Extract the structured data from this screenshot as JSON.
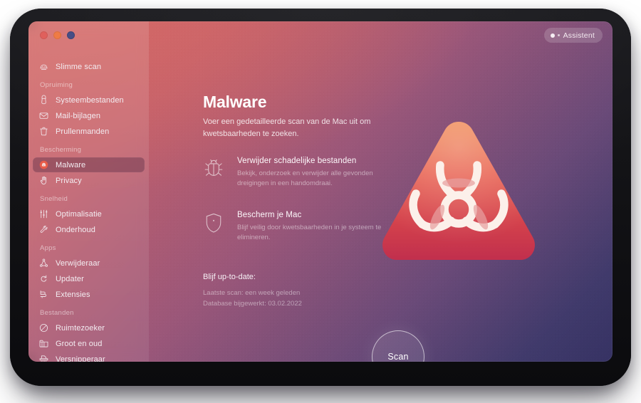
{
  "window": {
    "traffic_lights": [
      {
        "name": "close",
        "color": "#e0605c"
      },
      {
        "name": "minimize",
        "color": "#ef7b45"
      },
      {
        "name": "maximize",
        "color": "#474e86"
      }
    ],
    "assistant_label": "Assistent"
  },
  "sidebar": {
    "top_item": {
      "label": "Slimme scan",
      "icon": "smart-scan-icon"
    },
    "groups": [
      {
        "label": "Opruiming",
        "items": [
          {
            "label": "Systeembestanden",
            "icon": "system-junk-icon"
          },
          {
            "label": "Mail-bijlagen",
            "icon": "mail-icon"
          },
          {
            "label": "Prullenmanden",
            "icon": "trash-icon"
          }
        ]
      },
      {
        "label": "Bescherming",
        "items": [
          {
            "label": "Malware",
            "icon": "biohazard-icon",
            "active": true
          },
          {
            "label": "Privacy",
            "icon": "privacy-hand-icon"
          }
        ]
      },
      {
        "label": "Snelheid",
        "items": [
          {
            "label": "Optimalisatie",
            "icon": "sliders-icon"
          },
          {
            "label": "Onderhoud",
            "icon": "wrench-icon"
          }
        ]
      },
      {
        "label": "Apps",
        "items": [
          {
            "label": "Verwijderaar",
            "icon": "uninstaller-icon"
          },
          {
            "label": "Updater",
            "icon": "updater-refresh-icon"
          },
          {
            "label": "Extensies",
            "icon": "extensions-plug-icon"
          }
        ]
      },
      {
        "label": "Bestanden",
        "items": [
          {
            "label": "Ruimtezoeker",
            "icon": "space-lens-icon"
          },
          {
            "label": "Groot en oud",
            "icon": "folder-icon"
          },
          {
            "label": "Versnipperaar",
            "icon": "shredder-icon"
          }
        ]
      }
    ]
  },
  "main": {
    "title": "Malware",
    "subtitle": "Voer een gedetailleerde scan van de Mac uit om kwetsbaarheden te zoeken.",
    "features": [
      {
        "icon": "bug-icon",
        "title": "Verwijder schadelijke bestanden",
        "desc": "Bekijk, onderzoek en verwijder alle gevonden dreigingen in een handomdraai."
      },
      {
        "icon": "shield-icon",
        "title": "Bescherm je Mac",
        "desc": "Blijf veilig door kwetsbaarheden in je systeem te elimineren."
      }
    ],
    "status": {
      "heading": "Blijf up-to-date:",
      "last_scan": "Laatste scan: een week geleden",
      "database": "Database bijgewerkt: 03.02.2022"
    },
    "hero_icon": "biohazard-warning-triangle",
    "scan_button_label": "Scan"
  },
  "colors": {
    "gradient_start": "#ca6066",
    "gradient_mid": "#9b5779",
    "gradient_end": "#363263",
    "hero_top": "#ee7f52",
    "hero_bottom": "#c8354a",
    "bezel": "#131316"
  }
}
